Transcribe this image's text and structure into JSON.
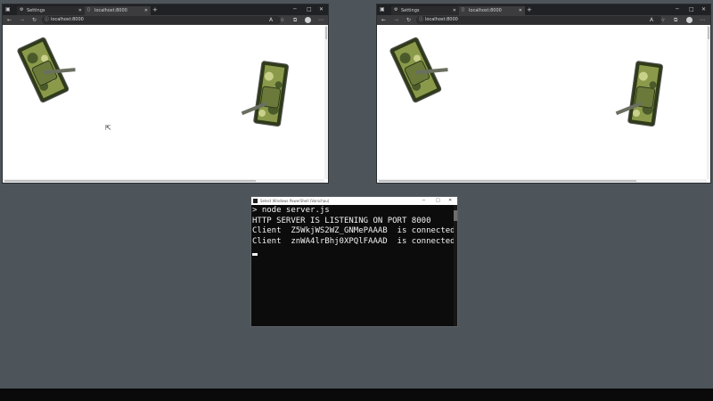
{
  "browser_left": {
    "tabs": [
      {
        "label": "Settings",
        "icon": "gear-icon"
      },
      {
        "label": "localhost:8000",
        "icon": "page-icon"
      }
    ],
    "url": "localhost:8000"
  },
  "browser_right": {
    "tabs": [
      {
        "label": "Settings",
        "icon": "gear-icon"
      },
      {
        "label": "localhost:8000",
        "icon": "page-icon"
      }
    ],
    "url": "localhost:8000"
  },
  "terminal": {
    "title": "Select Windows PowerShell (Vorschau)",
    "lines": [
      "> node server.js",
      "HTTP SERVER IS LISTENING ON PORT 8000",
      "Client  Z5WkjWS2WZ_GNMePAAAB  is connected",
      "Client  znWA4lrBhj0XPQlFAAAD  is connected"
    ]
  },
  "colors": {
    "desktop": "#4d555a",
    "browser_chrome": "#202124",
    "tank_camo": [
      "#4b5a2a",
      "#8a9a4a",
      "#c8d08a",
      "#2f3a1a"
    ]
  }
}
